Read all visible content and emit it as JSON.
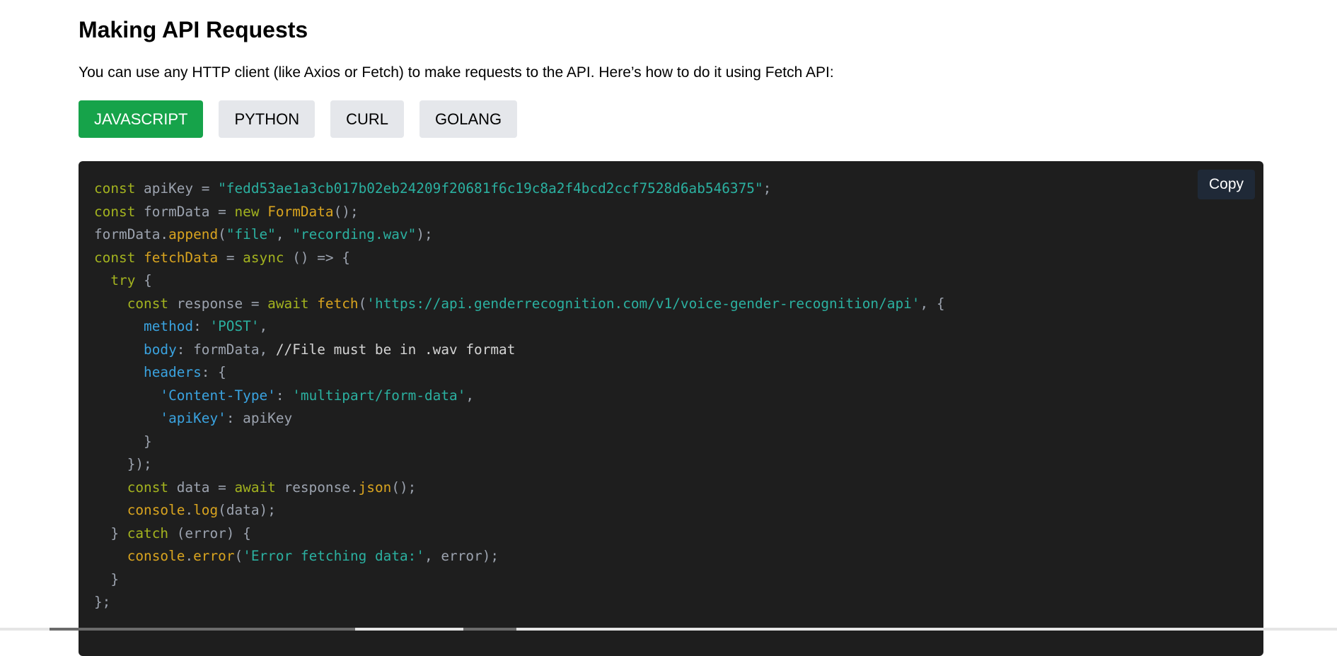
{
  "section": {
    "title": "Making API Requests",
    "intro": "You can use any HTTP client (like Axios or Fetch) to make requests to the API. Here’s how to do it using Fetch API:"
  },
  "tabs": [
    {
      "label": "JAVASCRIPT",
      "active": true
    },
    {
      "label": "PYTHON",
      "active": false
    },
    {
      "label": "CURL",
      "active": false
    },
    {
      "label": "GOLANG",
      "active": false
    }
  ],
  "code_block": {
    "copy_label": "Copy",
    "language": "javascript",
    "lines": [
      [
        [
          "kw",
          "const"
        ],
        [
          "var",
          " apiKey = "
        ],
        [
          "str",
          "\"fedd53ae1a3cb017b02eb24209f20681f6c19c8a2f4bcd2ccf7528d6ab546375\""
        ],
        [
          "var",
          ";"
        ]
      ],
      [
        [
          "kw",
          "const"
        ],
        [
          "var",
          " formData = "
        ],
        [
          "kw",
          "new"
        ],
        [
          "var",
          " "
        ],
        [
          "fn",
          "FormData"
        ],
        [
          "var",
          "();"
        ]
      ],
      [
        [
          "var",
          "formData."
        ],
        [
          "fn",
          "append"
        ],
        [
          "var",
          "("
        ],
        [
          "str",
          "\"file\""
        ],
        [
          "var",
          ", "
        ],
        [
          "str",
          "\"recording.wav\""
        ],
        [
          "var",
          ");"
        ]
      ],
      [
        [
          "kw",
          "const"
        ],
        [
          "var",
          " "
        ],
        [
          "fn",
          "fetchData"
        ],
        [
          "var",
          " = "
        ],
        [
          "kw",
          "async"
        ],
        [
          "var",
          " () => {"
        ]
      ],
      [
        [
          "var",
          "  "
        ],
        [
          "kw",
          "try"
        ],
        [
          "var",
          " {"
        ]
      ],
      [
        [
          "var",
          "    "
        ],
        [
          "kw",
          "const"
        ],
        [
          "var",
          " response = "
        ],
        [
          "kw",
          "await"
        ],
        [
          "var",
          " "
        ],
        [
          "fn",
          "fetch"
        ],
        [
          "var",
          "("
        ],
        [
          "str",
          "'https://api.genderrecognition.com/v1/voice-gender-recognition/api'"
        ],
        [
          "var",
          ", {"
        ]
      ],
      [
        [
          "var",
          "      "
        ],
        [
          "prop",
          "method"
        ],
        [
          "var",
          ": "
        ],
        [
          "str",
          "'POST'"
        ],
        [
          "var",
          ","
        ]
      ],
      [
        [
          "var",
          "      "
        ],
        [
          "prop",
          "body"
        ],
        [
          "var",
          ": formData, "
        ],
        [
          "cmt",
          "//File must be in .wav format"
        ]
      ],
      [
        [
          "var",
          "      "
        ],
        [
          "prop",
          "headers"
        ],
        [
          "var",
          ": {"
        ]
      ],
      [
        [
          "var",
          "        "
        ],
        [
          "prop",
          "'Content-Type'"
        ],
        [
          "var",
          ": "
        ],
        [
          "str",
          "'multipart/form-data'"
        ],
        [
          "var",
          ","
        ]
      ],
      [
        [
          "var",
          "        "
        ],
        [
          "prop",
          "'apiKey'"
        ],
        [
          "var",
          ": apiKey"
        ]
      ],
      [
        [
          "var",
          "      }"
        ]
      ],
      [
        [
          "var",
          "    });"
        ]
      ],
      [
        [
          "var",
          "    "
        ],
        [
          "kw",
          "const"
        ],
        [
          "var",
          " data = "
        ],
        [
          "kw",
          "await"
        ],
        [
          "var",
          " response."
        ],
        [
          "fn",
          "json"
        ],
        [
          "var",
          "();"
        ]
      ],
      [
        [
          "var",
          "    "
        ],
        [
          "fn",
          "console"
        ],
        [
          "var",
          "."
        ],
        [
          "fn",
          "log"
        ],
        [
          "var",
          "(data);"
        ]
      ],
      [
        [
          "var",
          "  } "
        ],
        [
          "kw",
          "catch"
        ],
        [
          "var",
          " (error) {"
        ]
      ],
      [
        [
          "var",
          "    "
        ],
        [
          "fn",
          "console"
        ],
        [
          "var",
          "."
        ],
        [
          "fn",
          "error"
        ],
        [
          "var",
          "("
        ],
        [
          "str",
          "'Error fetching data:'"
        ],
        [
          "var",
          ", error);"
        ]
      ],
      [
        [
          "var",
          "  }"
        ]
      ],
      [
        [
          "var",
          "};"
        ]
      ]
    ]
  },
  "colors": {
    "active_tab": "#16a34a",
    "inactive_tab": "#e5e7eb",
    "code_background": "#1e1e1e",
    "copy_button": "#1f2937"
  }
}
